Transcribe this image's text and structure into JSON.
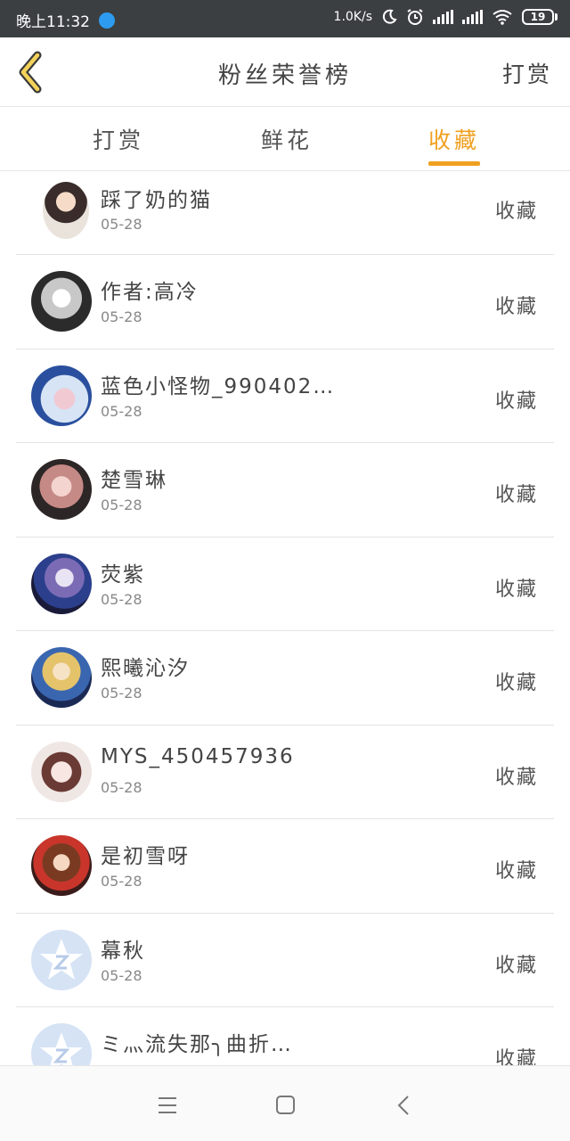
{
  "status_bar": {
    "time": "晚上11:32",
    "net_speed": "1.0K/s",
    "battery": "19"
  },
  "header": {
    "title": "粉丝荣誉榜",
    "action": "打赏"
  },
  "tabs": [
    {
      "label": "打赏",
      "active": false
    },
    {
      "label": "鲜花",
      "active": false
    },
    {
      "label": "收藏",
      "active": true
    }
  ],
  "colors": {
    "accent": "#f0a020",
    "status_bar": "#3b3f42"
  },
  "fans": [
    {
      "name": "踩了奶的猫",
      "date": "05-28",
      "action": "收藏",
      "avatar": "anime-girl-avatar"
    },
    {
      "name": "作者:高冷",
      "date": "05-28",
      "action": "收藏",
      "avatar": "anime-girl-eyepatch-avatar"
    },
    {
      "name": "蓝色小怪物_990402…",
      "date": "05-28",
      "action": "收藏",
      "avatar": "anime-boy-blue-avatar"
    },
    {
      "name": "楚雪琳",
      "date": "05-28",
      "action": "收藏",
      "avatar": "photo-girl-avatar"
    },
    {
      "name": "荧紫",
      "date": "05-28",
      "action": "收藏",
      "avatar": "anime-purple-avatar"
    },
    {
      "name": "熙曦沁汐",
      "date": "05-28",
      "action": "收藏",
      "avatar": "anime-blonde-avatar"
    },
    {
      "name": "MYS_450457936",
      "date": "05-28",
      "action": "收藏",
      "avatar": "photo-girl-avatar"
    },
    {
      "name": "是初雪呀",
      "date": "05-28",
      "action": "收藏",
      "avatar": "anime-red-avatar"
    },
    {
      "name": "幕秋",
      "date": "05-28",
      "action": "收藏",
      "avatar": "default-star-avatar"
    },
    {
      "name": "ミ灬流失那╮曲折…",
      "date": "",
      "action": "收藏",
      "avatar": "default-star-avatar"
    }
  ]
}
